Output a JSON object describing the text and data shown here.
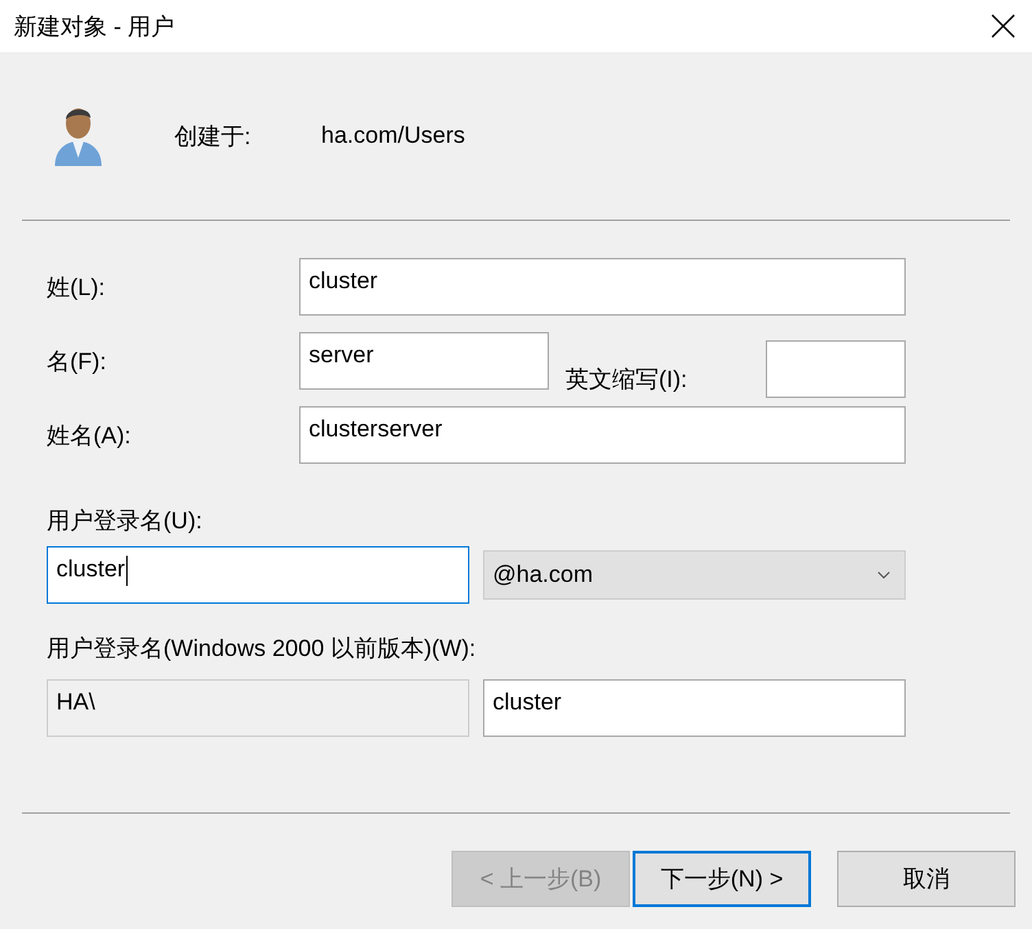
{
  "window": {
    "title": "新建对象 - 用户"
  },
  "header": {
    "label": "创建于:",
    "value": "ha.com/Users"
  },
  "last_name": {
    "label": "姓(L):",
    "value": "cluster"
  },
  "first_name": {
    "label": "名(F):",
    "value": "server"
  },
  "initials": {
    "label": "英文缩写(I):"
  },
  "full_name": {
    "label": "姓名(A):",
    "value": "clusterserver"
  },
  "logon_name": {
    "label": "用户登录名(U):",
    "value": "cluster",
    "focused": true
  },
  "domain": {
    "value": "@ha.com"
  },
  "pre2000": {
    "label": "用户登录名(Windows 2000 以前版本)(W):",
    "prefix": "HA\\",
    "value": "cluster"
  },
  "buttons": [
    {
      "label": "< 上一步(B)",
      "disabled": true,
      "default": false
    },
    {
      "label": "下一步(N) >",
      "disabled": false,
      "default": true
    },
    {
      "label": "取消",
      "disabled": false,
      "default": false
    }
  ]
}
